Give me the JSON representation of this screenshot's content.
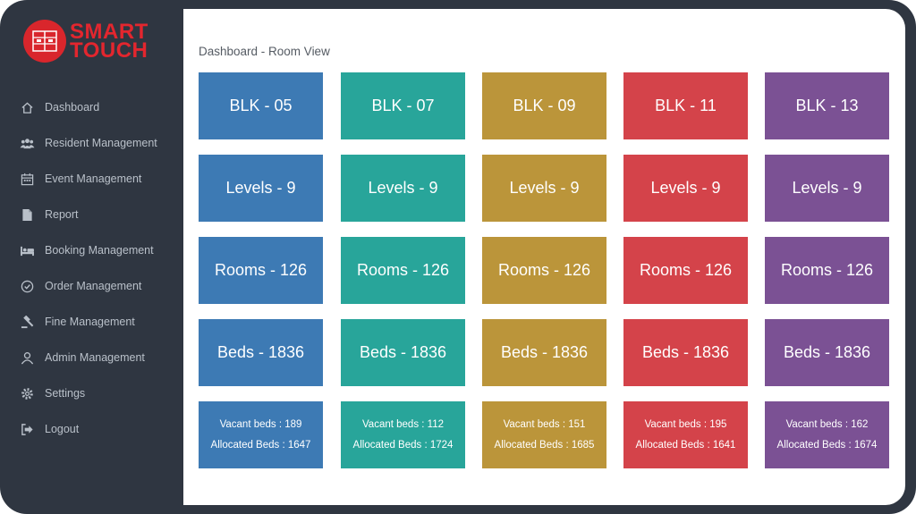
{
  "brand": {
    "line1": "SMART",
    "line2": "TOUCH"
  },
  "sidebar": {
    "items": [
      {
        "label": "Dashboard",
        "icon": "home-icon"
      },
      {
        "label": "Resident Management",
        "icon": "users-icon"
      },
      {
        "label": "Event Management",
        "icon": "calendar-icon"
      },
      {
        "label": "Report",
        "icon": "document-icon"
      },
      {
        "label": "Booking Management",
        "icon": "bed-icon"
      },
      {
        "label": "Order Management",
        "icon": "check-circle-icon"
      },
      {
        "label": "Fine Management",
        "icon": "gavel-icon"
      },
      {
        "label": "Admin Management",
        "icon": "user-icon"
      },
      {
        "label": "Settings",
        "icon": "gear-icon"
      },
      {
        "label": "Logout",
        "icon": "logout-icon"
      }
    ]
  },
  "main": {
    "title": "Dashboard - Room View"
  },
  "blocks": [
    {
      "color": "#3d7ab4",
      "blk": "BLK - 05",
      "levels": "Levels - 9",
      "rooms": "Rooms - 126",
      "beds": "Beds - 1836",
      "vacant": "Vacant beds : 189",
      "allocated": "Allocated Beds : 1647"
    },
    {
      "color": "#28a59a",
      "blk": "BLK - 07",
      "levels": "Levels - 9",
      "rooms": "Rooms - 126",
      "beds": "Beds - 1836",
      "vacant": "Vacant beds : 112",
      "allocated": "Allocated Beds : 1724"
    },
    {
      "color": "#bb953a",
      "blk": "BLK - 09",
      "levels": "Levels - 9",
      "rooms": "Rooms - 126",
      "beds": "Beds - 1836",
      "vacant": "Vacant beds : 151",
      "allocated": "Allocated Beds : 1685"
    },
    {
      "color": "#d4434a",
      "blk": "BLK - 11",
      "levels": "Levels - 9",
      "rooms": "Rooms - 126",
      "beds": "Beds - 1836",
      "vacant": "Vacant beds : 195",
      "allocated": "Allocated Beds : 1641"
    },
    {
      "color": "#7b5194",
      "blk": "BLK - 13",
      "levels": "Levels - 9",
      "rooms": "Rooms - 126",
      "beds": "Beds - 1836",
      "vacant": "Vacant beds : 162",
      "allocated": "Allocated Beds : 1674"
    }
  ]
}
